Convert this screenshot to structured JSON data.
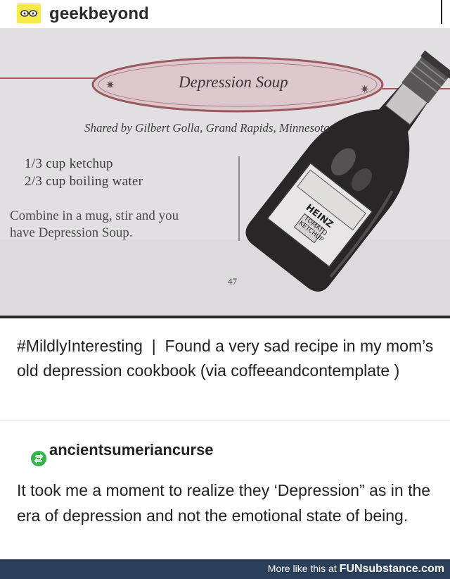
{
  "header": {
    "blog_name": "geekbeyond",
    "avatar_icon": "glasses-icon"
  },
  "photo": {
    "recipe_title": "Depression Soup",
    "shared_by": "Shared by Gilbert Golla, Grand Rapids, Minnesota",
    "ingredients": [
      "1/3  cup ketchup",
      "2/3  cup boiling water"
    ],
    "directions_line1": "Combine in a mug, stir and you",
    "directions_line2": "have Depression Soup.",
    "page_number": "47",
    "bottle_label_brand": "HEINZ",
    "bottle_label_line1": "TOMATO",
    "bottle_label_line2": "KETCHUP"
  },
  "post": {
    "tag": "#MildlyInteresting",
    "separator": "|",
    "caption": "Found a very sad recipe in my mom’s old depression cookbook (via coffeeandcontemplate )"
  },
  "reblog": {
    "icon": "reblog-icon",
    "username": "ancientsumeriancurse",
    "comment": "It took me a moment to realize they ‘Depression” as in the era of depression and not the emotional state of being."
  },
  "footer": {
    "more_text": "More like this at",
    "brand": "FUNsubstance.com",
    "colors": {
      "banner": "#2a3f58",
      "reblog_green": "#34b44a",
      "avatar_yellow": "#f7e84b"
    }
  }
}
